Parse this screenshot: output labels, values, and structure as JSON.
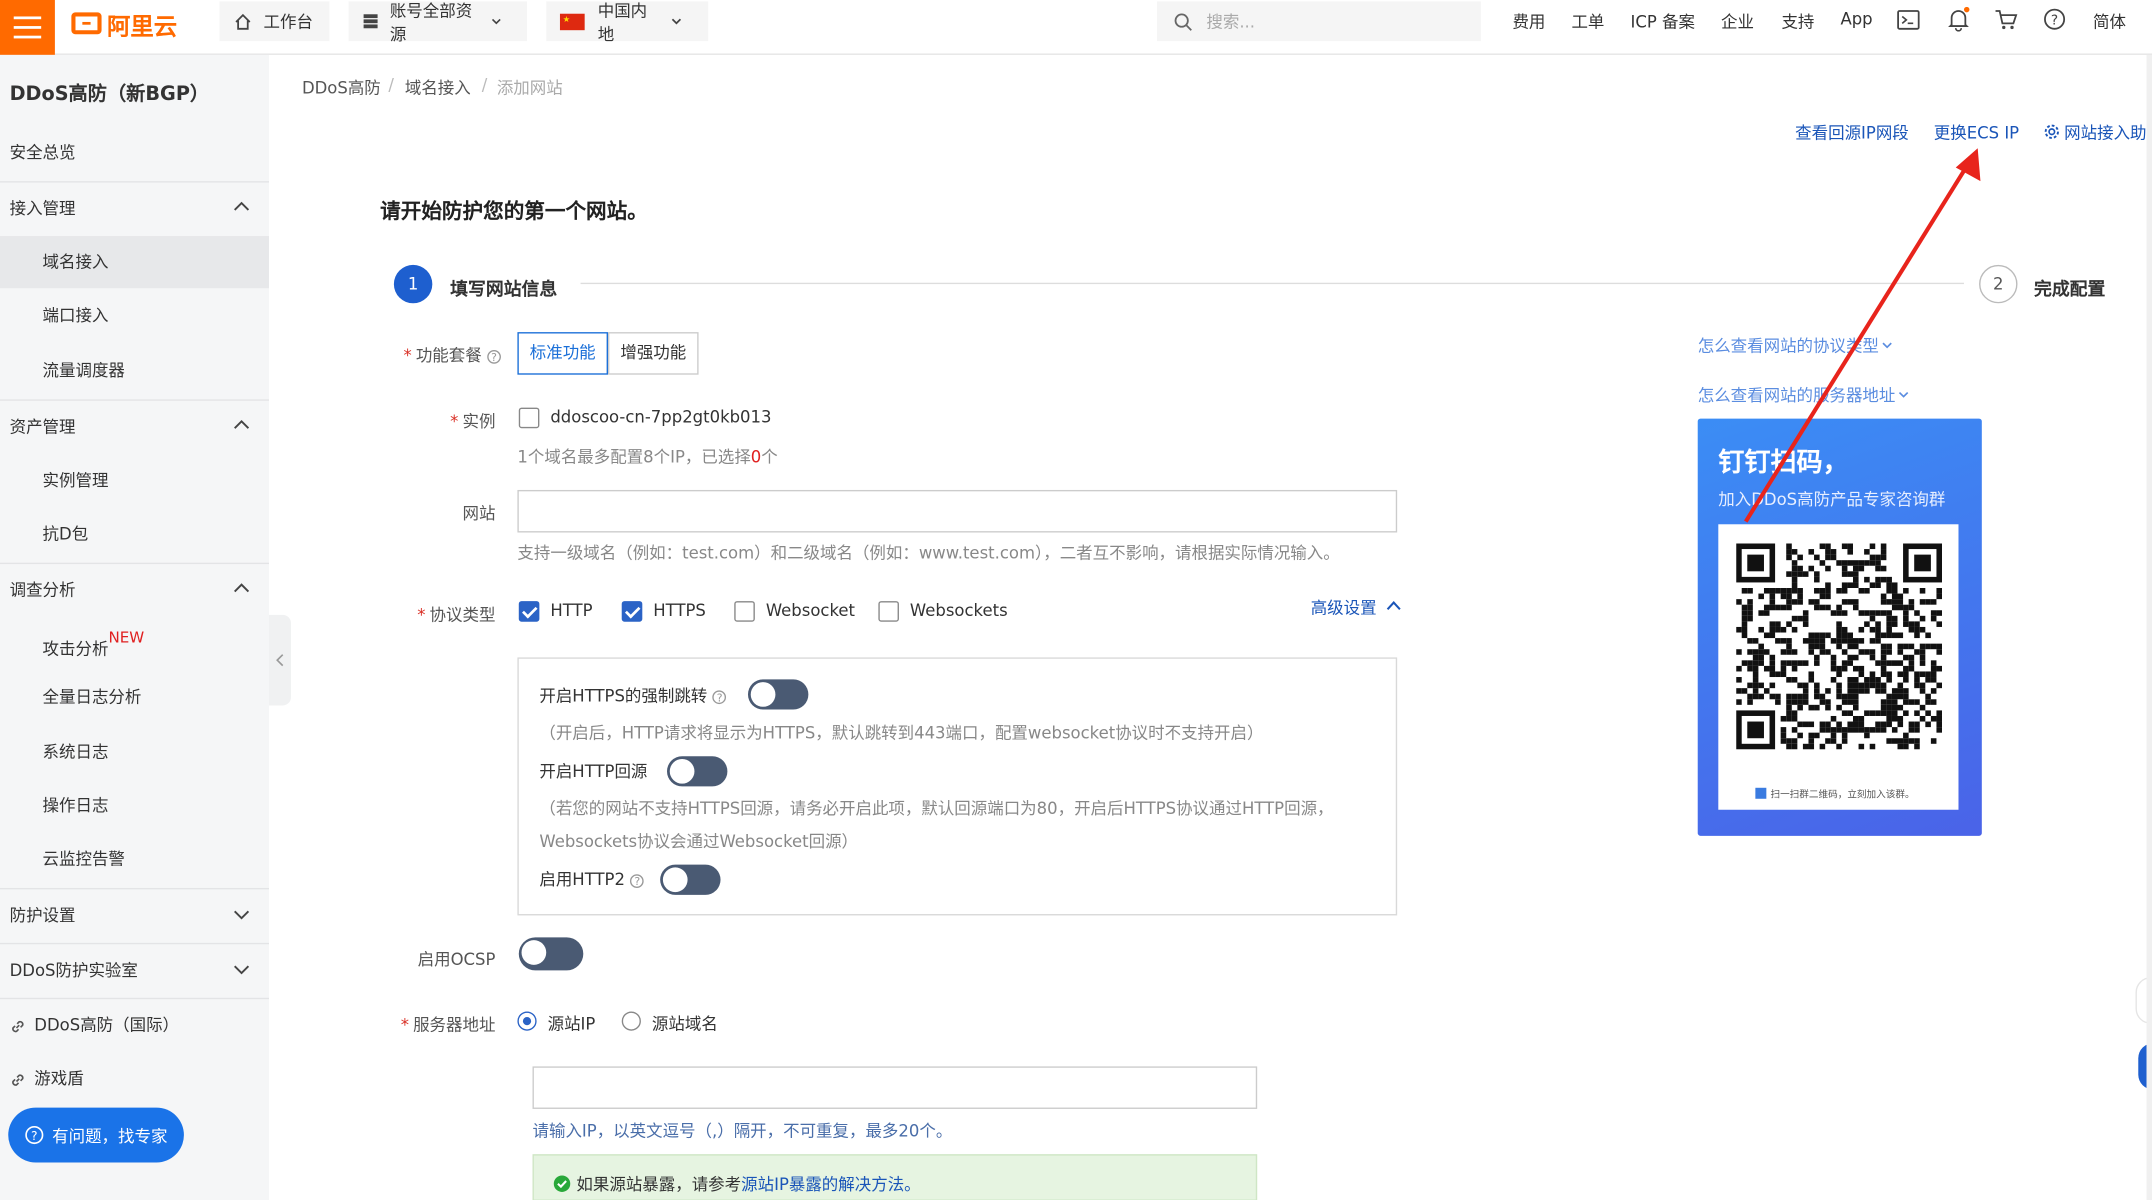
{
  "topbar": {
    "logo_text": "阿里云",
    "workbench": "工作台",
    "resources": "账号全部资源",
    "region": "中国内地",
    "search_placeholder": "搜索...",
    "nav": [
      "费用",
      "工单",
      "ICP 备案",
      "企业",
      "支持",
      "App"
    ],
    "lang": "简体",
    "accent_color": "#ff6a00"
  },
  "sidebar": {
    "title": "DDoS高防（新BGP）",
    "items": [
      {
        "label": "安全总览"
      },
      {
        "label": "接入管理"
      },
      {
        "label": "域名接入"
      },
      {
        "label": "端口接入"
      },
      {
        "label": "流量调度器"
      },
      {
        "label": "资产管理"
      },
      {
        "label": "实例管理"
      },
      {
        "label": "抗D包"
      },
      {
        "label": "调查分析"
      },
      {
        "label": "攻击分析",
        "badge": "NEW"
      },
      {
        "label": "全量日志分析"
      },
      {
        "label": "系统日志"
      },
      {
        "label": "操作日志"
      },
      {
        "label": "云监控告警"
      },
      {
        "label": "防护设置"
      },
      {
        "label": "DDoS防护实验室"
      },
      {
        "label": "DDoS高防（国际）"
      },
      {
        "label": "游戏盾"
      }
    ],
    "help_button": "有问题，找专家"
  },
  "breadcrumb": [
    "DDoS高防",
    "域名接入",
    "添加网站"
  ],
  "toplinks": {
    "view_ip": "查看回源IP网段",
    "change_ecs": "更换ECS IP",
    "assistant": "网站接入助手"
  },
  "page_title": "请开始防护您的第一个网站。",
  "steps": [
    {
      "num": "1",
      "label": "填写网站信息"
    },
    {
      "num": "2",
      "label": "完成配置"
    }
  ],
  "form": {
    "package_label": "功能套餐",
    "package_options": [
      "标准功能",
      "增强功能"
    ],
    "instance_label": "实例",
    "instance_value": "ddoscoo-cn-7pp2gt0kb013",
    "instance_hint_pre": "1个域名最多配置8个IP，已选择",
    "instance_hint_count": "0",
    "instance_hint_post": "个",
    "website_label": "网站",
    "website_hint": "支持一级域名（例如：test.com）和二级域名（例如：www.test.com），二者互不影响，请根据实际情况输入。",
    "protocol_label": "协议类型",
    "protocols": [
      "HTTP",
      "HTTPS",
      "Websocket",
      "Websockets"
    ],
    "advanced": "高级设置",
    "https_redirect": "开启HTTPS的强制跳转",
    "https_redirect_hint": "（开启后，HTTP请求将显示为HTTPS，默认跳转到443端口，配置websocket协议时不支持开启）",
    "http_origin": "开启HTTP回源",
    "http_origin_hint1": "（若您的网站不支持HTTPS回源，请务必开启此项，默认回源端口为80，开启后HTTPS协议通过HTTP回源，",
    "http_origin_hint2": "Websockets协议会通过Websocket回源）",
    "http2": "启用HTTP2",
    "ocsp_label": "启用OCSP",
    "server_label": "服务器地址",
    "server_options": [
      "源站IP",
      "源站域名"
    ],
    "server_hint": "请输入IP，以英文逗号（,）隔开，不可重复，最多20个。",
    "success_pre": "如果源站暴露，请参考",
    "success_link": "源站IP暴露的解决方法。"
  },
  "right": {
    "link1": "怎么查看网站的协议类型",
    "link2": "怎么查看网站的服务器地址",
    "qr_title": "钉钉扫码，",
    "qr_sub": "加入DDoS高防产品专家咨询群",
    "qr_footer": "扫一扫群二维码，立刻加入该群。"
  }
}
